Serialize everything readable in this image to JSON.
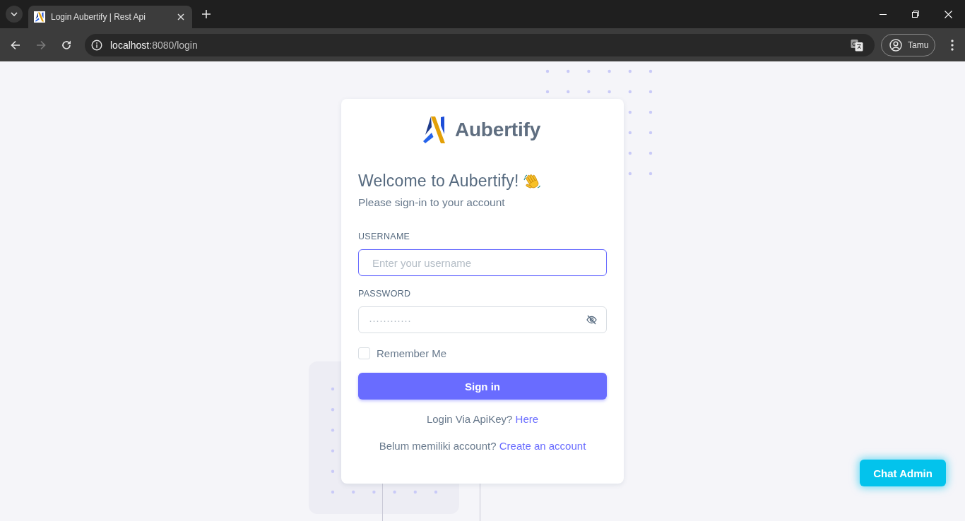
{
  "browser": {
    "tabs": [
      {
        "title": "Login Aubertify | Rest Api",
        "selected": true
      }
    ],
    "forward_disabled": true,
    "address": {
      "host": "localhost",
      "path": ":8080/login"
    },
    "profile": "Tamu"
  },
  "brand": "Aubertify",
  "heading": "Welcome to Aubertify!",
  "subheading": "Please sign-in to your account",
  "fields": [
    {
      "kind": "text",
      "label": "USERNAME",
      "placeholder": "Enter your username",
      "focused": true
    },
    {
      "kind": "password",
      "label": "PASSWORD",
      "placeholder": "············",
      "focused": false
    }
  ],
  "remember": {
    "label": "Remember Me",
    "checked": false
  },
  "submit": "Sign in",
  "prompts": [
    {
      "text": "Login Via ApiKey?",
      "link": "Here"
    },
    {
      "text": "Belum memiliki account?",
      "link": "Create an account"
    }
  ],
  "chat_button": "Chat Admin"
}
